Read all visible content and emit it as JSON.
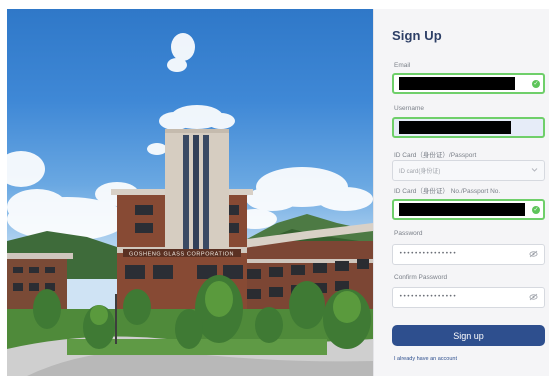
{
  "hero": {
    "building_sign": "GOSHENG GLASS CORPORATION"
  },
  "form": {
    "title": "Sign Up",
    "email_label": "Email",
    "username_label": "Username",
    "id_type_label": "ID Card（身份证）/Passport",
    "id_type_value": "ID card(身份证)",
    "id_number_label": "ID Card（身份证） No./Passport No.",
    "password_label": "Password",
    "password_value": "•••••••••••••••",
    "confirm_label": "Confirm Password",
    "confirm_value": "•••••••••••••••",
    "submit_label": "Sign up",
    "login_link": "I already have an account"
  },
  "colors": {
    "accent": "#2e4f8e",
    "title": "#2d3f66",
    "valid_border": "#6fcf6a",
    "username_fill": "#e6ecf8"
  },
  "icons": {
    "valid": "check-circle-icon",
    "password_toggle": "eye-off-icon",
    "select": "chevron-down-icon"
  }
}
